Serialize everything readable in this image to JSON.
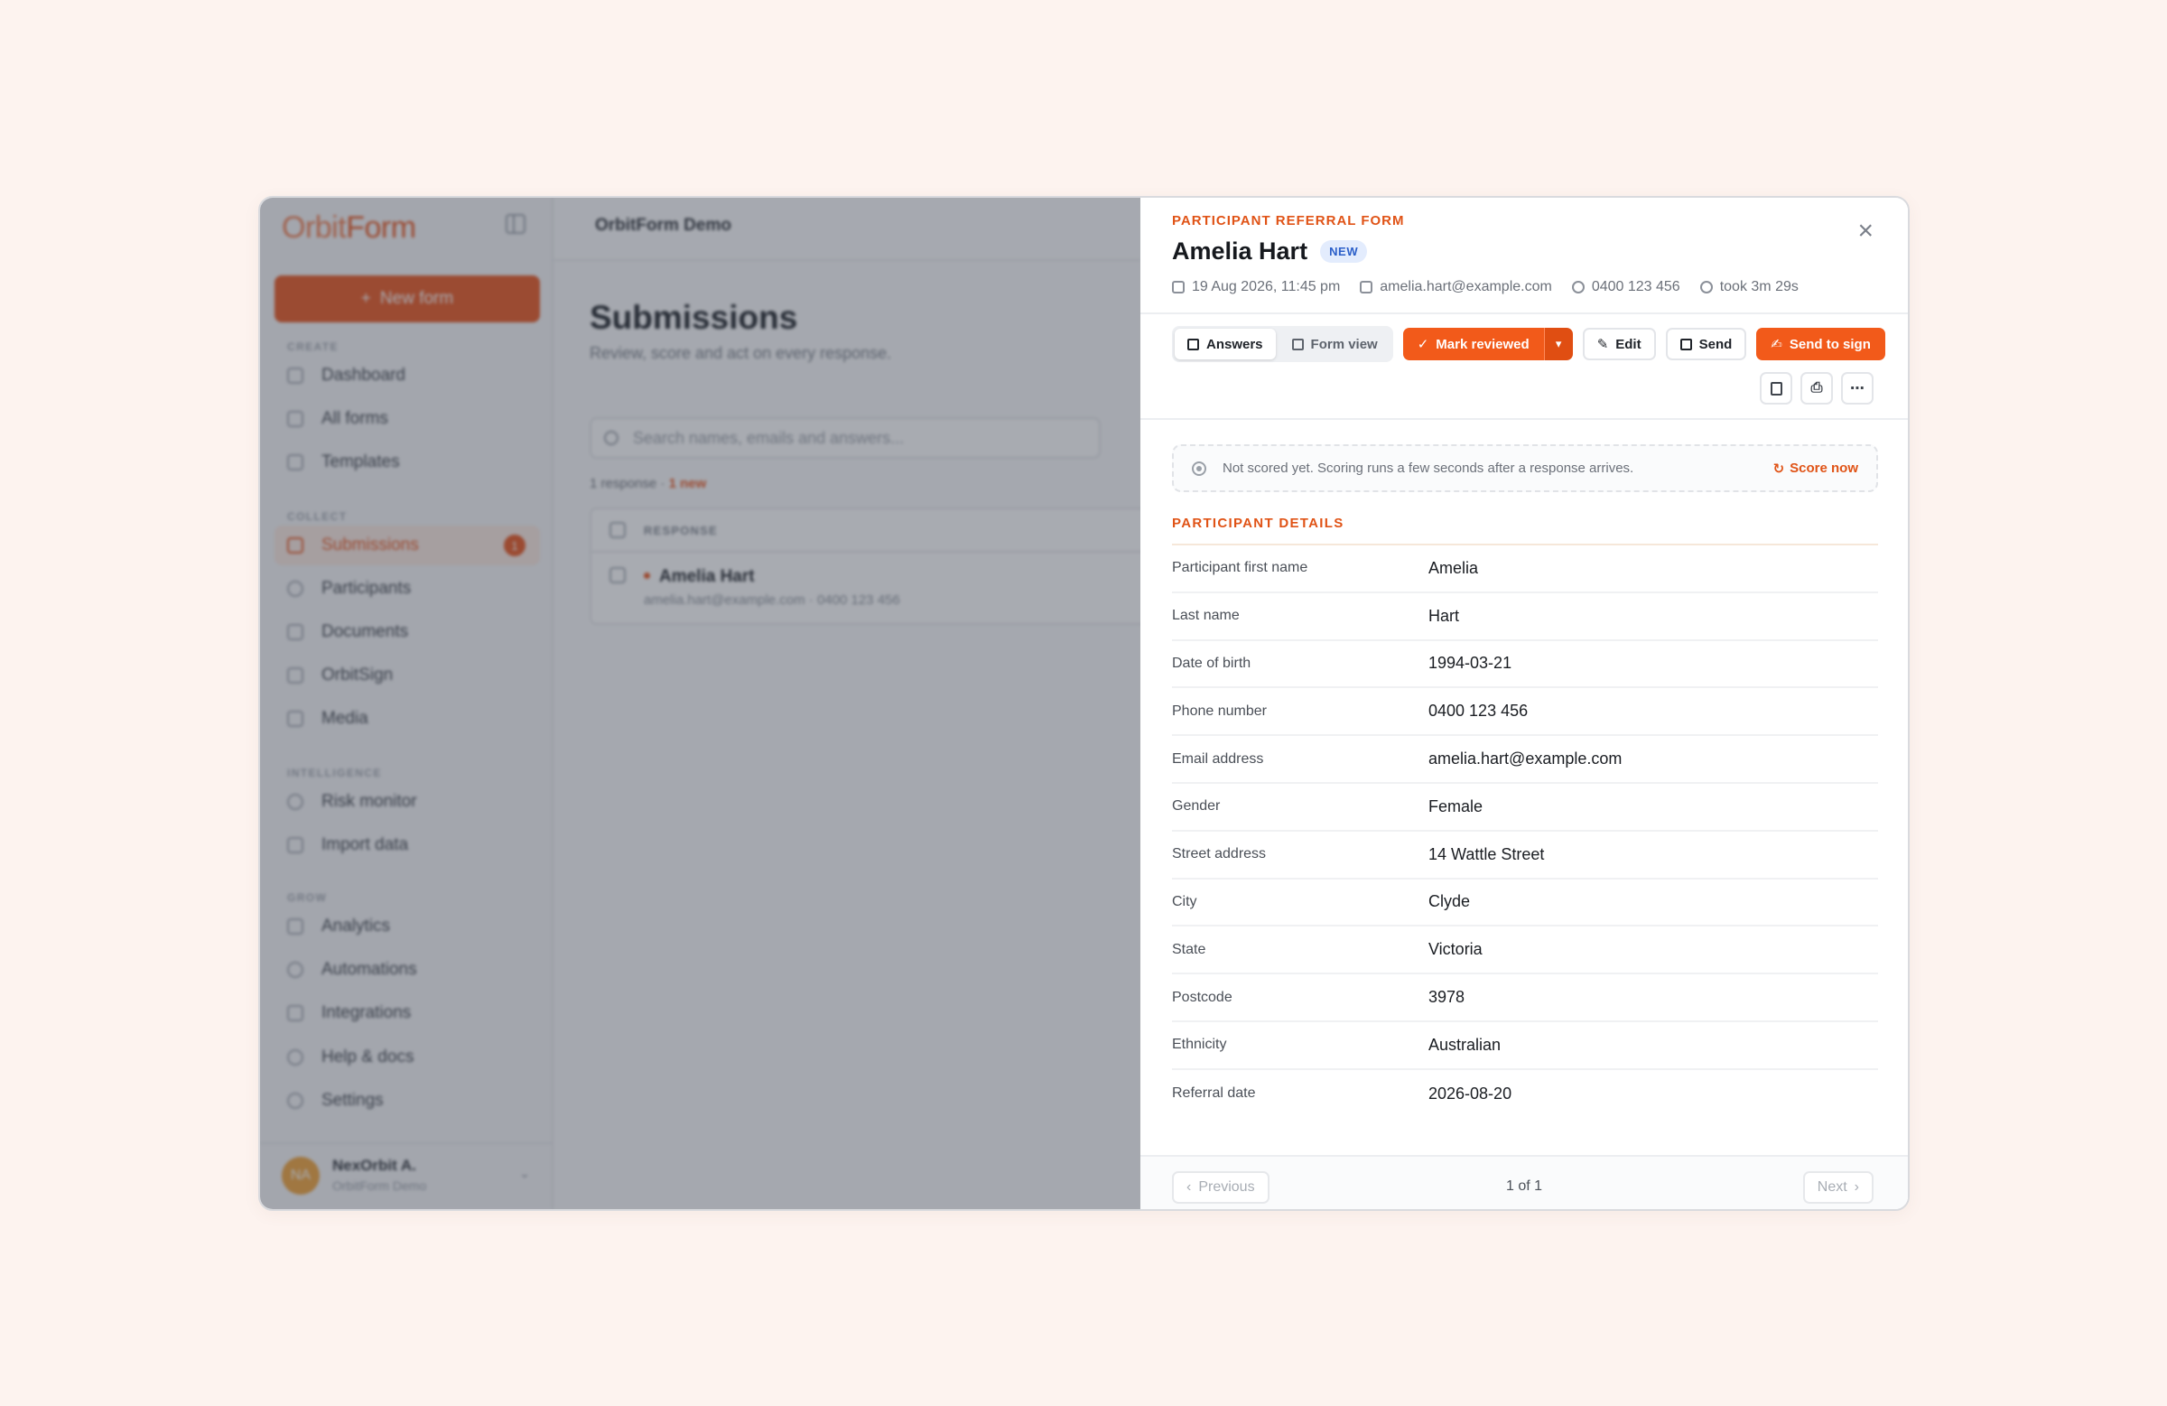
{
  "app": {
    "logo_part1": "Orbit",
    "logo_part2": "Form",
    "new_form_label": "New form",
    "sections": {
      "create": "CREATE",
      "collect": "COLLECT",
      "intelligence": "INTELLIGENCE",
      "grow": "GROW"
    },
    "nav": {
      "dashboard": "Dashboard",
      "all_forms": "All forms",
      "templates": "Templates",
      "submissions": "Submissions",
      "submissions_badge": "1",
      "participants": "Participants",
      "documents": "Documents",
      "orbitsign": "OrbitSign",
      "media": "Media",
      "risk_monitor": "Risk monitor",
      "import_data": "Import data",
      "analytics": "Analytics",
      "automations": "Automations",
      "integrations": "Integrations",
      "help_docs": "Help & docs",
      "settings": "Settings"
    },
    "user": {
      "initials": "NA",
      "name": "NexOrbit A.",
      "org": "OrbitForm Demo"
    },
    "breadcrumb": "OrbitForm Demo",
    "page_title": "Submissions",
    "page_subtitle": "Review, score and act on every response.",
    "search_placeholder": "Search names, emails and answers...",
    "response_count": "1 response ·",
    "response_new": "1 new",
    "table_header": "RESPONSE",
    "row": {
      "name": "Amelia Hart",
      "meta": "amelia.hart@example.com · 0400 123 456"
    }
  },
  "panel": {
    "eyebrow": "PARTICIPANT REFERRAL FORM",
    "title": "Amelia Hart",
    "badge": "NEW",
    "meta": {
      "date": "19 Aug 2026, 11:45 pm",
      "email": "amelia.hart@example.com",
      "phone": "0400 123 456",
      "duration": "took 3m 29s"
    },
    "tabs": {
      "answers": "Answers",
      "form_view": "Form view"
    },
    "actions": {
      "mark_reviewed": "Mark reviewed",
      "edit": "Edit",
      "send": "Send",
      "send_to_sign": "Send to sign"
    },
    "score": {
      "message": "Not scored yet. Scoring runs a few seconds after a response arrives.",
      "action": "Score now"
    },
    "section_title": "PARTICIPANT DETAILS",
    "fields": [
      {
        "label": "Participant first name",
        "value": "Amelia"
      },
      {
        "label": "Last name",
        "value": "Hart"
      },
      {
        "label": "Date of birth",
        "value": "1994-03-21"
      },
      {
        "label": "Phone number",
        "value": "0400 123 456"
      },
      {
        "label": "Email address",
        "value": "amelia.hart@example.com"
      },
      {
        "label": "Gender",
        "value": "Female"
      },
      {
        "label": "Street address",
        "value": "14 Wattle Street"
      },
      {
        "label": "City",
        "value": "Clyde"
      },
      {
        "label": "State",
        "value": "Victoria"
      },
      {
        "label": "Postcode",
        "value": "3978"
      },
      {
        "label": "Ethnicity",
        "value": "Australian"
      },
      {
        "label": "Referral date",
        "value": "2026-08-20"
      }
    ],
    "pagination": {
      "previous": "Previous",
      "page": "1 of 1",
      "next": "Next"
    }
  },
  "colors": {
    "accent": "#e8541d",
    "badge_blue": "#2b5fc9",
    "background": "#fdf3ef"
  }
}
